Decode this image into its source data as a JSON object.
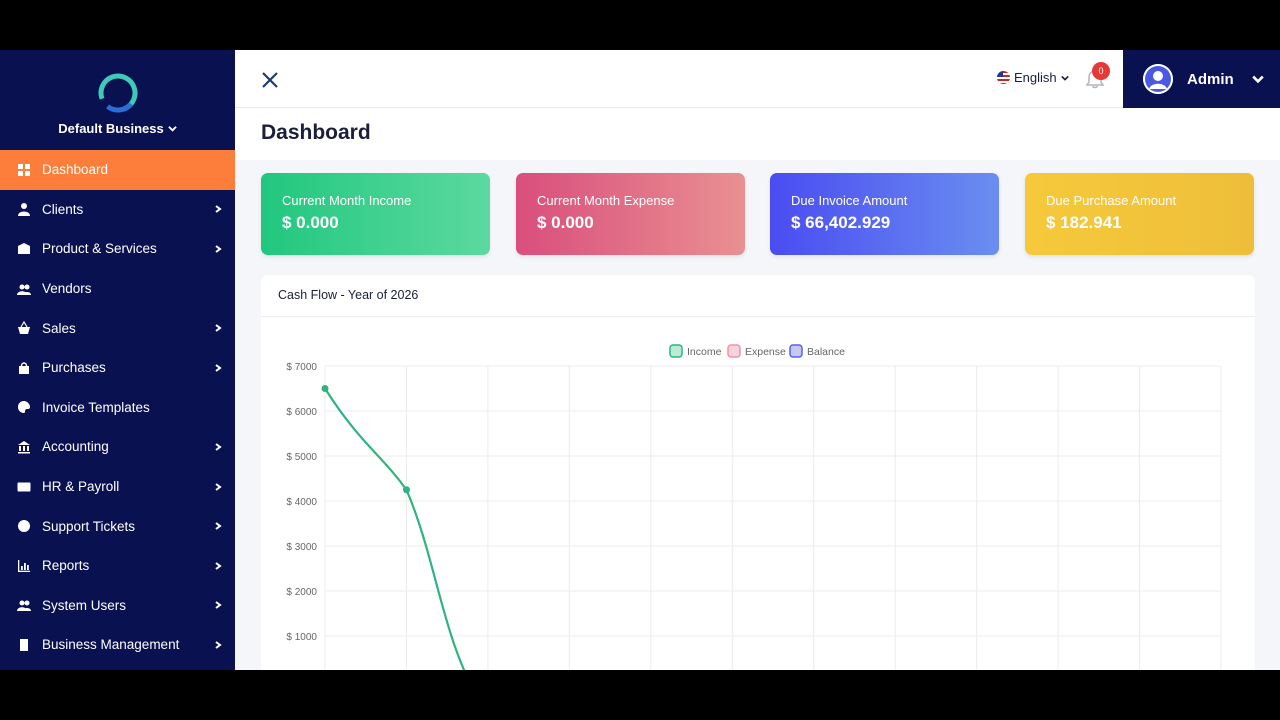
{
  "sidebar": {
    "business_name": "Default Business",
    "items": [
      {
        "label": "Dashboard",
        "icon": "dashboard-icon",
        "active": true,
        "submenu": false
      },
      {
        "label": "Clients",
        "icon": "user-icon",
        "active": false,
        "submenu": true
      },
      {
        "label": "Product & Services",
        "icon": "box-icon",
        "active": false,
        "submenu": true
      },
      {
        "label": "Vendors",
        "icon": "users-icon",
        "active": false,
        "submenu": false
      },
      {
        "label": "Sales",
        "icon": "basket-icon",
        "active": false,
        "submenu": true
      },
      {
        "label": "Purchases",
        "icon": "bag-icon",
        "active": false,
        "submenu": true
      },
      {
        "label": "Invoice Templates",
        "icon": "palette-icon",
        "active": false,
        "submenu": false
      },
      {
        "label": "Accounting",
        "icon": "bank-icon",
        "active": false,
        "submenu": true
      },
      {
        "label": "HR & Payroll",
        "icon": "id-card-icon",
        "active": false,
        "submenu": true
      },
      {
        "label": "Support Tickets",
        "icon": "lifebuoy-icon",
        "active": false,
        "submenu": true
      },
      {
        "label": "Reports",
        "icon": "bar-chart-icon",
        "active": false,
        "submenu": true
      },
      {
        "label": "System Users",
        "icon": "users-icon",
        "active": false,
        "submenu": true
      },
      {
        "label": "Business Management",
        "icon": "building-icon",
        "active": false,
        "submenu": true
      }
    ]
  },
  "header": {
    "language": "English",
    "notification_count": "0",
    "user_name": "Admin"
  },
  "page": {
    "title": "Dashboard"
  },
  "cards": [
    {
      "label": "Current Month Income",
      "value": "$ 0.000"
    },
    {
      "label": "Current Month Expense",
      "value": "$ 0.000"
    },
    {
      "label": "Due Invoice Amount",
      "value": "$ 66,402.929"
    },
    {
      "label": "Due Purchase Amount",
      "value": "$ 182.941"
    }
  ],
  "panel": {
    "title": "Cash Flow - Year of 2026"
  },
  "colors": {
    "sidebar_bg": "#0a1150",
    "active_item": "#fd7e3b",
    "income": "#2fb380",
    "expense": "#f48fa8",
    "balance": "#5a5ee6"
  },
  "chart_data": {
    "type": "line",
    "title": "",
    "legend": [
      "Income",
      "Expense",
      "Balance"
    ],
    "legend_position": "top-center",
    "yticks": [
      "$ 7000",
      "$ 6000",
      "$ 5000",
      "$ 4000",
      "$ 3000",
      "$ 2000",
      "$ 1000"
    ],
    "ylim": [
      0,
      7000
    ],
    "grid": true,
    "series": [
      {
        "name": "Income",
        "values": [
          6500,
          4250,
          0
        ]
      }
    ]
  }
}
